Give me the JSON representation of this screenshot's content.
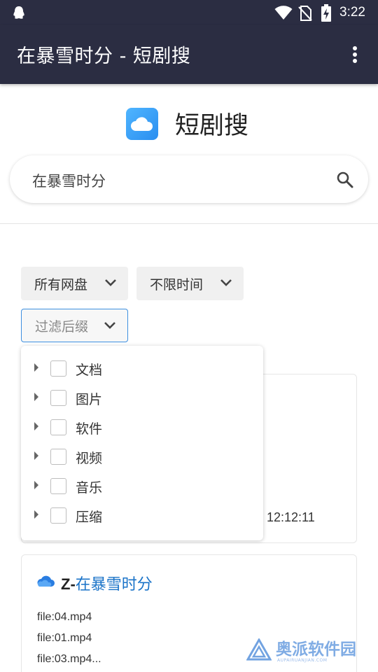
{
  "status_bar": {
    "time": "3:22"
  },
  "app_bar": {
    "title": "在暴雪时分 - 短剧搜"
  },
  "brand": {
    "name": "短剧搜"
  },
  "search": {
    "value": "在暴雪时分"
  },
  "filters": {
    "disk": "所有网盘",
    "time": "不限时间",
    "suffix": "过滤后缀"
  },
  "suffix_options": [
    {
      "label": "文档",
      "checked": false
    },
    {
      "label": "图片",
      "checked": false
    },
    {
      "label": "软件",
      "checked": false
    },
    {
      "label": "视频",
      "checked": false
    },
    {
      "label": "音乐",
      "checked": false
    },
    {
      "label": "压缩",
      "checked": false
    }
  ],
  "results": [
    {
      "date_fragment": "7 12:12:11"
    },
    {
      "prefix": "Z-",
      "name": "在暴雪时分",
      "files": [
        "file:04.mp4",
        "file:01.mp4",
        "file:03.mp4..."
      ]
    }
  ],
  "watermark": {
    "text": "奥派软件园",
    "sub": "AUPAIRUANJIAN.COM"
  },
  "colors": {
    "app_bar": "#2b2d42",
    "accent": "#1a73c8",
    "logo": "#2a8ef0"
  }
}
